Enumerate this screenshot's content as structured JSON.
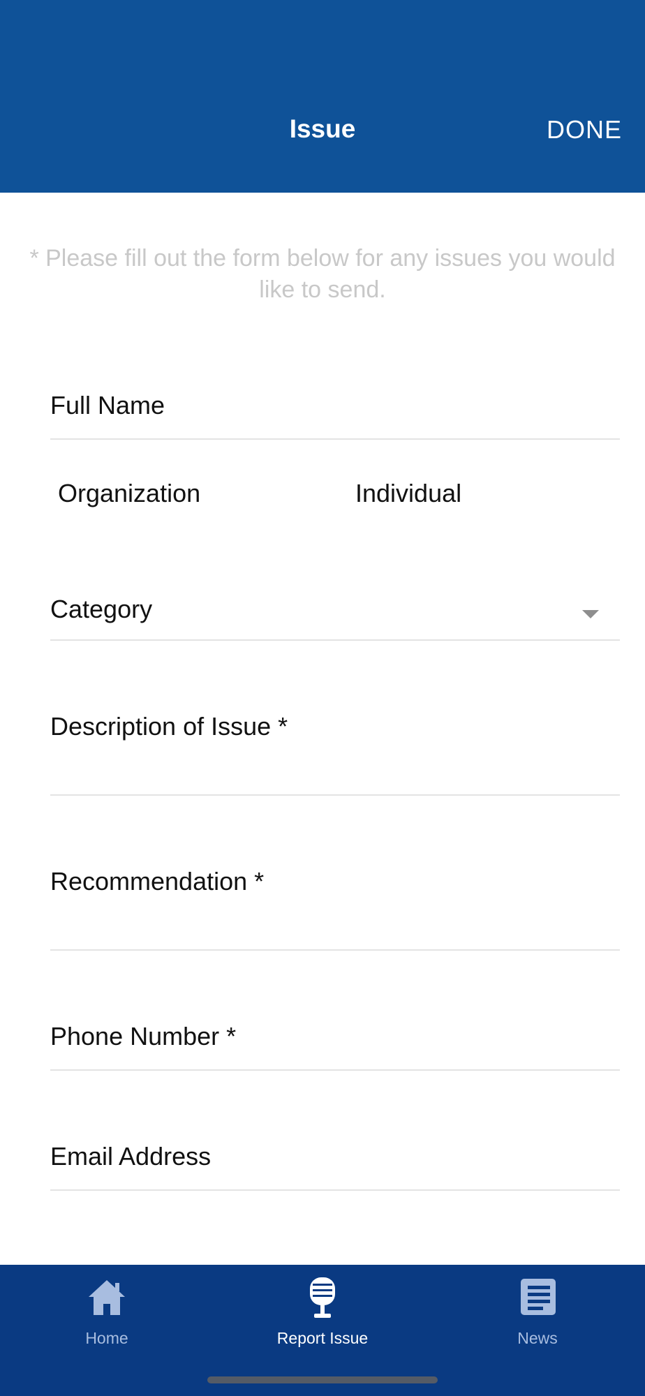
{
  "header": {
    "title": "Issue",
    "done_label": "DONE"
  },
  "hint": "* Please fill out the form below for any issues you would like to send.",
  "form": {
    "full_name_label": "Full Name",
    "type_options": [
      "Organization",
      "Individual"
    ],
    "category_label": "Category",
    "description_label": "Description of Issue *",
    "recommendation_label": "Recommendation *",
    "phone_label": "Phone Number *",
    "email_label": "Email Address"
  },
  "tabbar": {
    "tabs": [
      {
        "label": "Home",
        "icon": "home-icon",
        "active": false
      },
      {
        "label": "Report Issue",
        "icon": "microphone-icon",
        "active": true
      },
      {
        "label": "News",
        "icon": "news-icon",
        "active": false
      }
    ]
  },
  "colors": {
    "header_bg": "#0f5298",
    "tabbar_bg": "#0a3a82",
    "hint_text": "#c8c8c8",
    "inactive_tab": "#a8bde0"
  }
}
